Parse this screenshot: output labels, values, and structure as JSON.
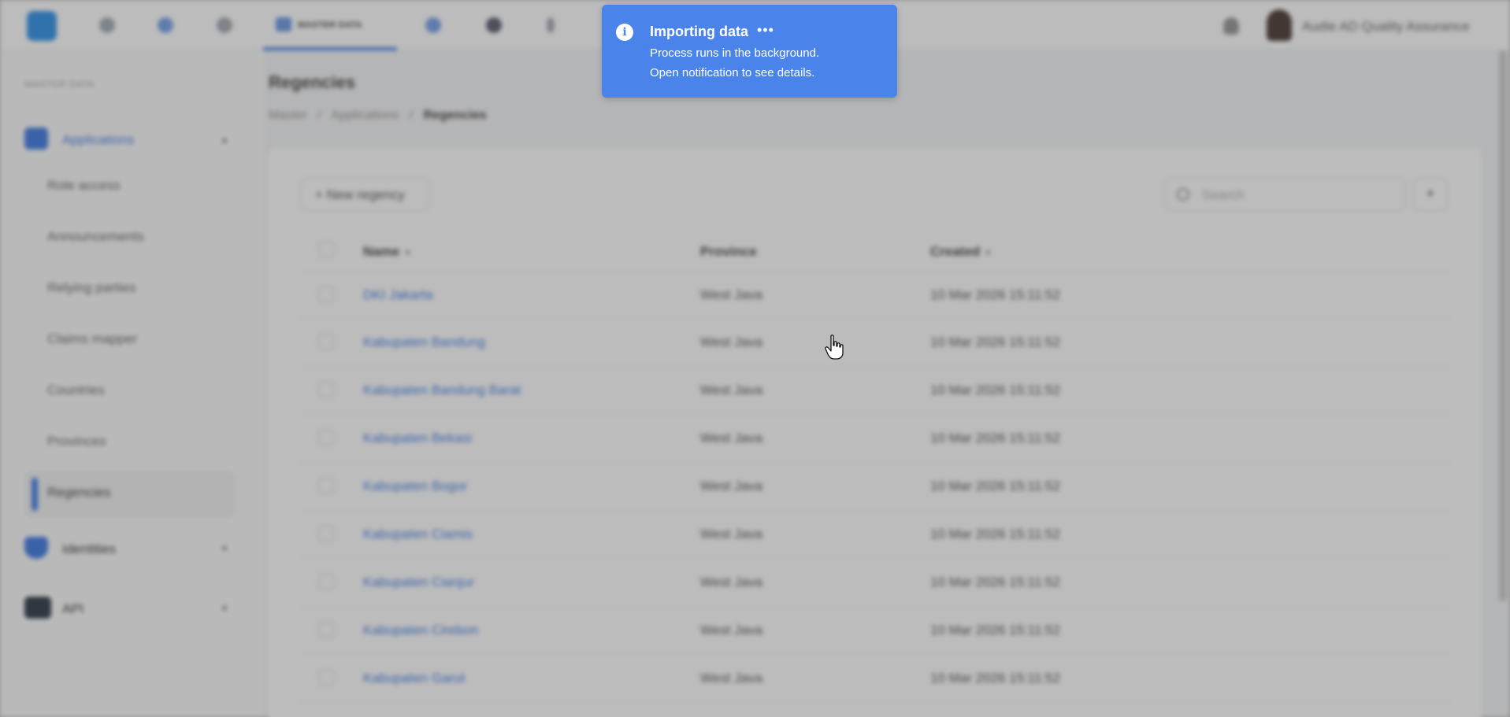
{
  "topbar": {
    "active_nav_label": "MASTER DATA",
    "user_name": "Audie AD Quality Assurance"
  },
  "sidebar": {
    "section_label": "MASTER DATA",
    "groups": [
      {
        "label": "Applications",
        "icon": "apps-icon",
        "color": "#2f6fe0"
      },
      {
        "label": "Identities",
        "icon": "shield-icon",
        "color": "#2f6fe0"
      },
      {
        "label": "API",
        "icon": "terminal-icon",
        "color": "#1f2937"
      }
    ],
    "items": [
      {
        "label": "Role access"
      },
      {
        "label": "Announcements"
      },
      {
        "label": "Relying parties"
      },
      {
        "label": "Claims mapper"
      },
      {
        "label": "Countries"
      },
      {
        "label": "Provinces"
      },
      {
        "label": "Regencies"
      }
    ]
  },
  "main": {
    "page_title": "Regencies",
    "breadcrumb": [
      "Master",
      "Applications",
      "Regencies"
    ],
    "new_button_label": "+ New regency",
    "search_placeholder": "Search",
    "table": {
      "columns": [
        "Name",
        "Province",
        "Created"
      ],
      "rows": [
        {
          "name": "DKI Jakarta",
          "province": "West Java",
          "created": "10 Mar 2026 15:11:52"
        },
        {
          "name": "Kabupaten Bandung",
          "province": "West Java",
          "created": "10 Mar 2026 15:11:52"
        },
        {
          "name": "Kabupaten Bandung Barat",
          "province": "West Java",
          "created": "10 Mar 2026 15:11:52"
        },
        {
          "name": "Kabupaten Bekasi",
          "province": "West Java",
          "created": "10 Mar 2026 15:11:52"
        },
        {
          "name": "Kabupaten Bogor",
          "province": "West Java",
          "created": "10 Mar 2026 15:11:52"
        },
        {
          "name": "Kabupaten Ciamis",
          "province": "West Java",
          "created": "10 Mar 2026 15:11:52"
        },
        {
          "name": "Kabupaten Cianjur",
          "province": "West Java",
          "created": "10 Mar 2026 15:11:52"
        },
        {
          "name": "Kabupaten Cirebon",
          "province": "West Java",
          "created": "10 Mar 2026 15:11:52"
        },
        {
          "name": "Kabupaten Garut",
          "province": "West Java",
          "created": "10 Mar 2026 15:11:52"
        }
      ]
    }
  },
  "toast": {
    "title": "Importing data",
    "dots": "•••",
    "line1": "Process runs in the background.",
    "line2": "Open notification to see details.",
    "background_color": "#4a84ea"
  }
}
